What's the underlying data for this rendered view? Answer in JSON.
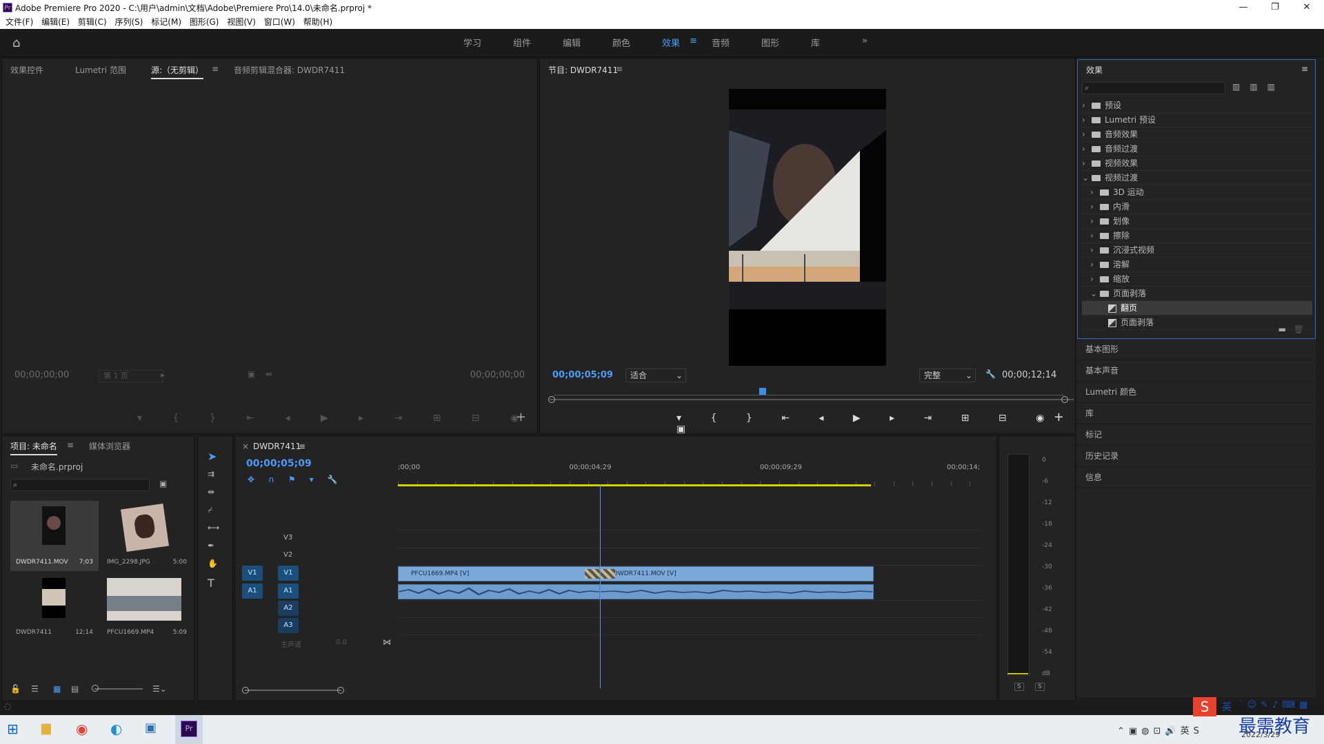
{
  "window": {
    "title": "Adobe Premiere Pro 2020 - C:\\用户\\admin\\文档\\Adobe\\Premiere Pro\\14.0\\未命名.prproj *",
    "app_badge": "Pr",
    "minimize": "—",
    "maximize": "❐",
    "close": "✕"
  },
  "menu": [
    "文件(F)",
    "编辑(E)",
    "剪辑(C)",
    "序列(S)",
    "标记(M)",
    "图形(G)",
    "视图(V)",
    "窗口(W)",
    "帮助(H)"
  ],
  "workspaces": [
    "学习",
    "组件",
    "编辑",
    "颜色",
    "效果",
    "音频",
    "图形",
    "库"
  ],
  "workspace_active": "效果",
  "workspace_more": "»",
  "source_panel": {
    "tabs": [
      "效果控件",
      "Lumetri 范围",
      "源:（无剪辑）",
      "音频剪辑混合器: DWDR7411"
    ],
    "active_tab": "源:（无剪辑）",
    "timecode_left": "00;00;00;00",
    "timecode_right": "00;00;00;00",
    "page_select": "第 1 页"
  },
  "program_panel": {
    "title": "节目: DWDR7411",
    "timecode": "00;00;05;09",
    "fit": "适合",
    "quality": "完整",
    "duration": "00;00;12;14",
    "playhead_fraction": 0.41
  },
  "effects_panel": {
    "title": "效果",
    "search_placeholder": "",
    "tree": [
      {
        "label": "预设",
        "level": 0,
        "expanded": false,
        "kind": "preset"
      },
      {
        "label": "Lumetri 预设",
        "level": 0,
        "expanded": false,
        "kind": "preset"
      },
      {
        "label": "音频效果",
        "level": 0,
        "expanded": false,
        "kind": "folder"
      },
      {
        "label": "音频过渡",
        "level": 0,
        "expanded": false,
        "kind": "folder"
      },
      {
        "label": "视频效果",
        "level": 0,
        "expanded": false,
        "kind": "folder"
      },
      {
        "label": "视频过渡",
        "level": 0,
        "expanded": true,
        "kind": "folder"
      },
      {
        "label": "3D 运动",
        "level": 1,
        "expanded": false,
        "kind": "folder"
      },
      {
        "label": "内滑",
        "level": 1,
        "expanded": false,
        "kind": "folder"
      },
      {
        "label": "划像",
        "level": 1,
        "expanded": false,
        "kind": "folder"
      },
      {
        "label": "擦除",
        "level": 1,
        "expanded": false,
        "kind": "folder"
      },
      {
        "label": "沉浸式视频",
        "level": 1,
        "expanded": false,
        "kind": "folder"
      },
      {
        "label": "溶解",
        "level": 1,
        "expanded": false,
        "kind": "folder"
      },
      {
        "label": "缩放",
        "level": 1,
        "expanded": false,
        "kind": "folder"
      },
      {
        "label": "页面剥落",
        "level": 1,
        "expanded": true,
        "kind": "folder"
      },
      {
        "label": "翻页",
        "level": 2,
        "selected": true,
        "kind": "effect"
      },
      {
        "label": "页面剥落",
        "level": 2,
        "kind": "effect"
      }
    ]
  },
  "side_panels": [
    "基本图形",
    "基本声音",
    "Lumetri 颜色",
    "库",
    "标记",
    "历史记录",
    "信息"
  ],
  "project_panel": {
    "tabs": [
      "项目: 未命名",
      "媒体浏览器"
    ],
    "project_file": "未命名.prproj",
    "items": [
      {
        "name": "DWDR7411.MOV",
        "duration": "7;03"
      },
      {
        "name": "IMG_2298.JPG",
        "duration": "5:00"
      },
      {
        "name": "DWDR7411",
        "duration": "12;14"
      },
      {
        "name": "PFCU1669.MP4",
        "duration": "5:09"
      }
    ]
  },
  "timeline": {
    "sequence": "DWDR7411",
    "timecode": "00;00;05;09",
    "ruler": [
      ";00;00",
      "00;00;04;29",
      "00;00;09;29",
      "00;00;14;"
    ],
    "video_tracks": [
      "V3",
      "V2",
      "V1"
    ],
    "audio_tracks": [
      "A1",
      "A2",
      "A3"
    ],
    "master": "主声道",
    "master_value": "0.0",
    "source_v": "V1",
    "source_a": "A1",
    "clips": [
      {
        "name": "PFCU1669.MP4 [V]",
        "start": 0.0,
        "end": 5.3
      },
      {
        "name": "DWDR7411.MOV [V]",
        "start": 5.3,
        "end": 12.47
      }
    ],
    "playhead_seconds": 5.3,
    "total_seconds_visible": 15.3
  },
  "audio_meter": {
    "scale": [
      "0",
      "-6",
      "-12",
      "-18",
      "-24",
      "-30",
      "-36",
      "-42",
      "-48",
      "-54",
      "dB"
    ],
    "solo_left": "S",
    "solo_right": "S"
  },
  "taskbar": {
    "ime": "英",
    "date": "2022/3/29",
    "watermark": "最需教育"
  }
}
